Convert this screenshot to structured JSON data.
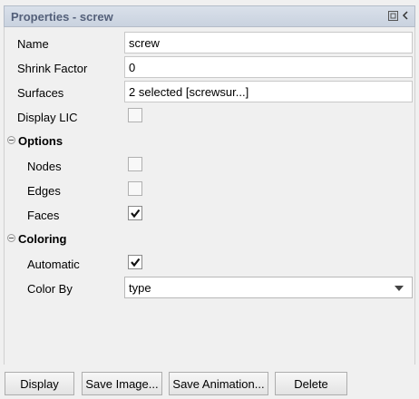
{
  "title": "Properties - screw",
  "icons": {
    "undock": "undock-icon",
    "collapse": "chevron-left-icon"
  },
  "fields": {
    "name": {
      "label": "Name",
      "value": "screw"
    },
    "shrink": {
      "label": "Shrink Factor",
      "value": "0"
    },
    "surfaces": {
      "label": "Surfaces",
      "value": "2 selected [screwsur...]"
    },
    "display_lic": {
      "label": "Display LIC",
      "checked": false
    }
  },
  "options": {
    "title": "Options",
    "nodes": {
      "label": "Nodes",
      "checked": false
    },
    "edges": {
      "label": "Edges",
      "checked": false
    },
    "faces": {
      "label": "Faces",
      "checked": true
    }
  },
  "coloring": {
    "title": "Coloring",
    "automatic": {
      "label": "Automatic",
      "checked": true
    },
    "color_by": {
      "label": "Color By",
      "value": "type"
    }
  },
  "buttons": {
    "display": "Display",
    "save_image": "Save Image...",
    "save_animation": "Save Animation...",
    "delete": "Delete"
  },
  "check_glyph": "✔"
}
